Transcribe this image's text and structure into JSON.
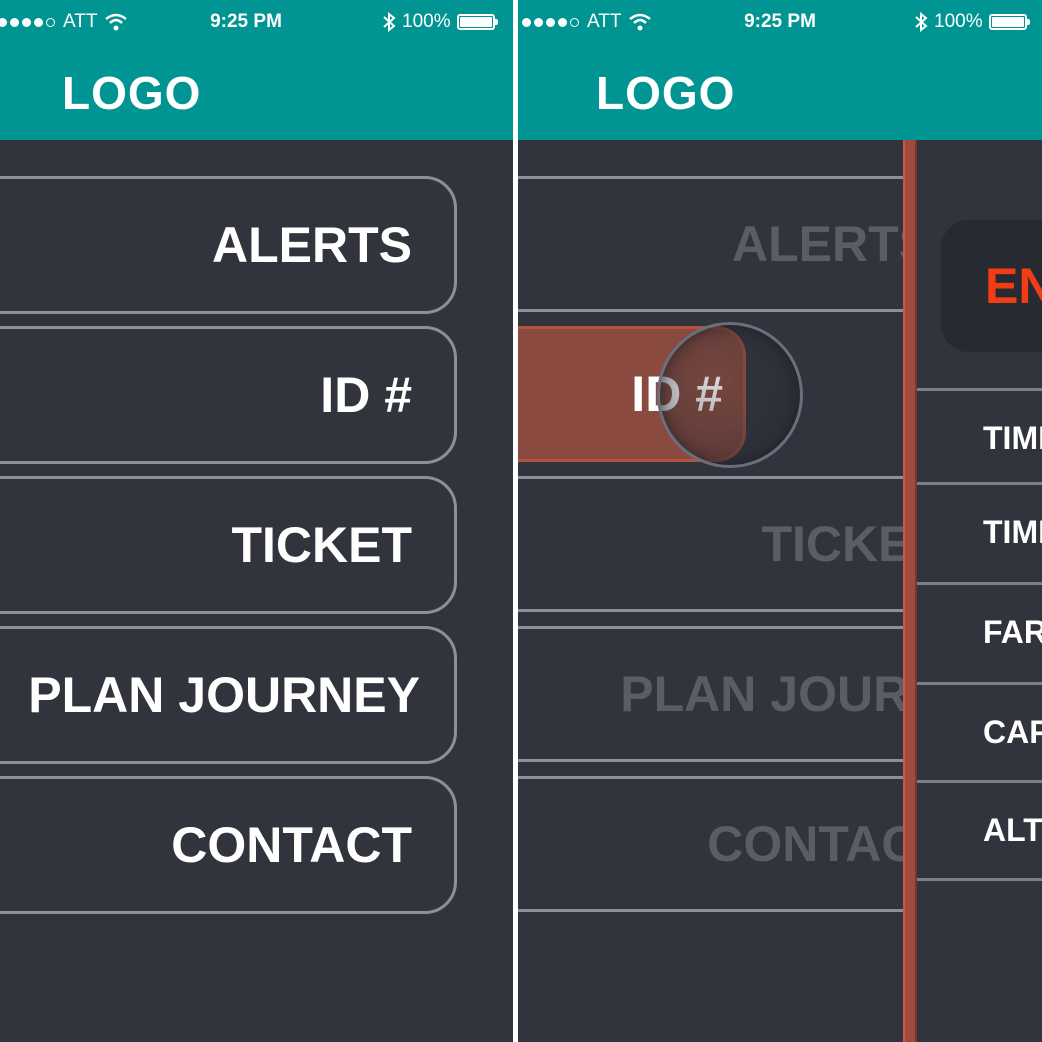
{
  "status_bar": {
    "carrier": "ATT",
    "time": "9:25 PM",
    "battery": "100%"
  },
  "header": {
    "logo": "LOGO"
  },
  "menu": {
    "items": [
      {
        "label": "ALERTS"
      },
      {
        "label": "ID #"
      },
      {
        "label": "TICKET"
      },
      {
        "label": "PLAN JOURNEY"
      },
      {
        "label": "CONTACT"
      }
    ]
  },
  "right_screen": {
    "dimmed_items": [
      {
        "label": "ALERTS"
      },
      {
        "label": "TICKET"
      },
      {
        "label": "PLAN JOURNEY"
      },
      {
        "label": "CONTACT"
      }
    ],
    "selected_item": {
      "label": "ID #"
    },
    "side_panel": {
      "language_button": "EN",
      "items": [
        {
          "label": "TIME"
        },
        {
          "label": "TIME"
        },
        {
          "label": "FAR"
        },
        {
          "label": "CAPA"
        },
        {
          "label": "ALTE"
        }
      ]
    },
    "colors": {
      "header": "#009592",
      "background": "#32343d",
      "accent": "#a24a3b",
      "language": "#f13d16"
    }
  }
}
